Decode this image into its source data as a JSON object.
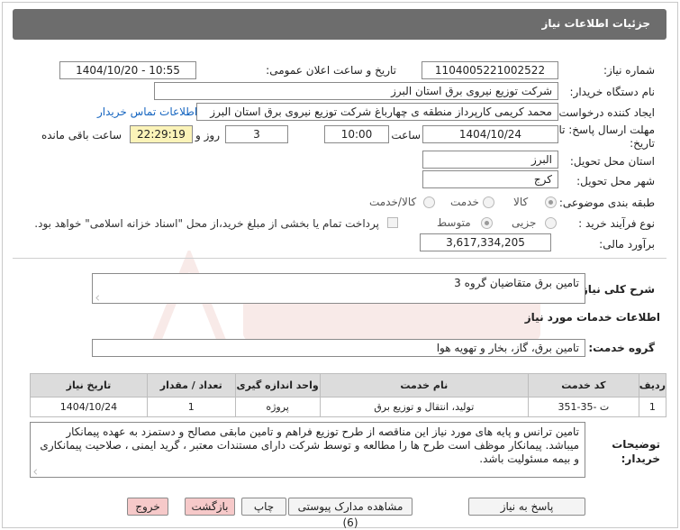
{
  "header": {
    "title": "جزئیات اطلاعات نیاز"
  },
  "form": {
    "need_number_label": "شماره نیاز:",
    "need_number": "1104005221002522",
    "announce_label": "تاریخ و ساعت اعلان عمومی:",
    "announce_value": "1404/10/20 - 10:55",
    "buyer_org_label": "نام دستگاه خریدار:",
    "buyer_org": "شرکت توزیع نیروی برق استان البرز",
    "creator_label": "ایجاد کننده درخواست:",
    "creator": "محمد کریمی کارپرداز منطقه ی چهارباغ شرکت توزیع نیروی برق استان البرز",
    "contact_link": "اطلاعات تماس خریدار",
    "deadline_label_line1": "مهلت ارسال پاسخ: تا",
    "deadline_label_line2": "تاریخ:",
    "deadline_date": "1404/10/24",
    "time_label": "ساعت",
    "deadline_time": "10:00",
    "days_value": "3",
    "days_label": "روز و",
    "remaining_time": "22:29:19",
    "remaining_label": "ساعت باقی مانده",
    "province_label": "استان محل تحویل:",
    "province": "البرز",
    "city_label": "شهر محل تحویل:",
    "city": "کرج",
    "category_label": "طبقه بندی موضوعی:",
    "category_options": [
      "کالا",
      "خدمت",
      "کالا/خدمت"
    ],
    "process_label": "نوع فرآیند خرید :",
    "process_options": [
      "جزیی",
      "متوسط"
    ],
    "payment_note": "پرداخت تمام یا بخشی از مبلغ خرید،از محل \"اسناد خزانه اسلامی\" خواهد بود.",
    "estimate_label": "برآورد مالی:",
    "estimate": "3,617,334,205"
  },
  "description": {
    "label": "شرح کلی نیاز:",
    "value": "تامین برق متقاضیان گروه 3"
  },
  "services": {
    "section_title": "اطلاعات خدمات مورد نیاز",
    "group_label": "گروه خدمت:",
    "group_value": "تامین برق، گاز، بخار و تهویه هوا",
    "table": {
      "headers": [
        "ردیف",
        "کد خدمت",
        "نام خدمت",
        "واحد اندازه گیری",
        "تعداد / مقدار",
        "تاریخ نیاز"
      ],
      "rows": [
        [
          "1",
          "ت -35-351",
          "تولید، انتقال و توزیع برق",
          "پروژه",
          "1",
          "1404/10/24"
        ]
      ]
    }
  },
  "buyer_notes": {
    "label_line1": "توضیحات",
    "label_line2": "خریدار:",
    "value": "تامین ترانس و پایه های مورد نیاز این مناقصه از طرح توزیع فراهم و تامین مابقی مصالح و دستمزد به عهده پیمانکار میباشد. پیمانکار موظف است طرح ها را مطالعه و توسط شرکت دارای مستندات معتبر ، گرید ایمنی ، صلاحیت پیمانکاری و بیمه مسئولیت باشد."
  },
  "buttons": {
    "reply": "پاسخ به نیاز",
    "view_docs": "مشاهده مدارک پیوستی (6)",
    "print": "چاپ",
    "back": "بازگشت",
    "exit": "خروج"
  },
  "colors": {
    "title_bar": "#6d6d6d",
    "yellow_field": "#fbf3b8",
    "link": "#1565c0",
    "pink_button": "#f6c9c9"
  }
}
